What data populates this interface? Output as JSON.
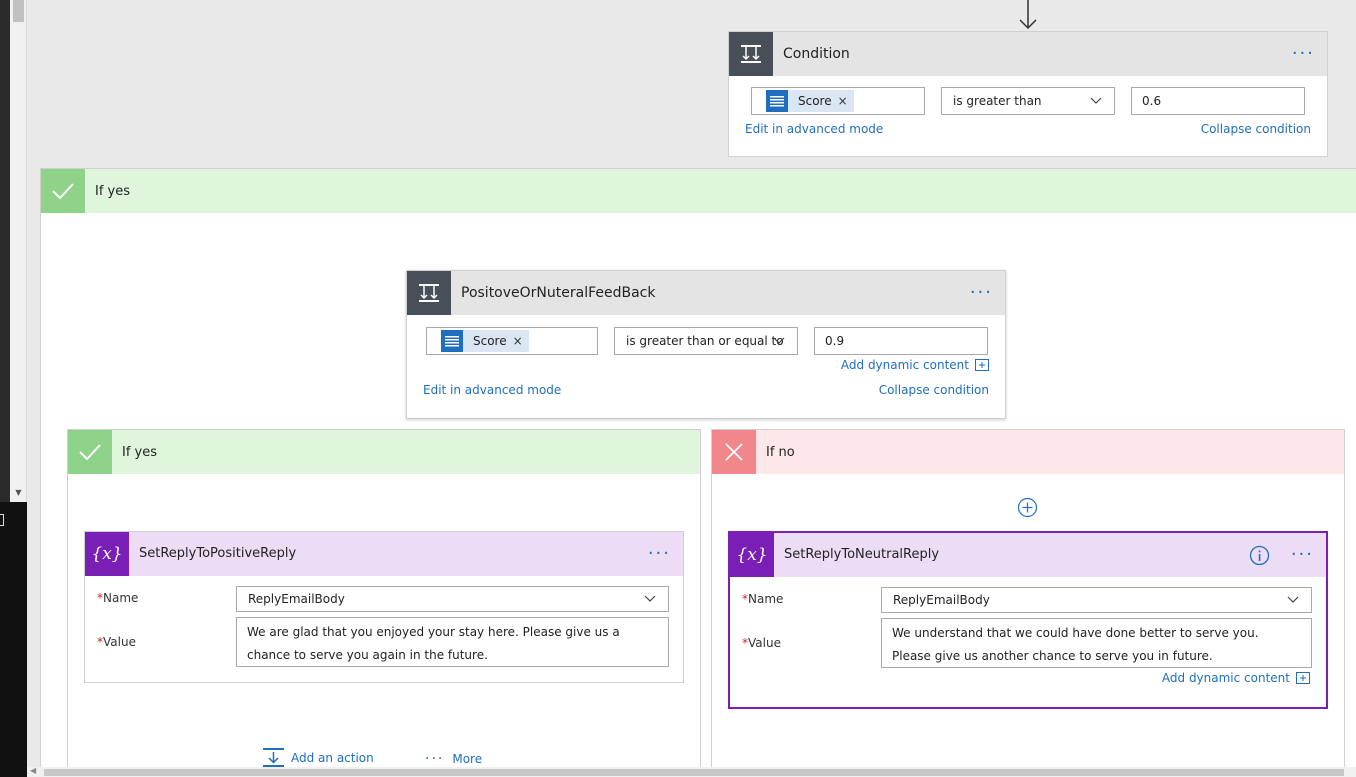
{
  "condition": {
    "title": "Condition",
    "token_label": "Score",
    "operator": "is greater than",
    "value": "0.6",
    "edit_advanced": "Edit in advanced mode",
    "collapse": "Collapse condition",
    "more": "···"
  },
  "outer_yes": {
    "label": "If yes"
  },
  "nested_condition": {
    "title": "PositoveOrNuteralFeedBack",
    "token_label": "Score",
    "operator": "is greater than or equal to",
    "value": "0.9",
    "add_dynamic": "Add dynamic content",
    "edit_advanced": "Edit in advanced mode",
    "collapse": "Collapse condition",
    "more": "···"
  },
  "inner_yes": {
    "label": "If yes",
    "action": {
      "title": "SetReplyToPositiveReply",
      "icon_text": "{x}",
      "name_label": "Name",
      "name_value": "ReplyEmailBody",
      "value_label": "Value",
      "value_text": "We are glad that you enjoyed your stay here. Please give us a chance to serve you again in the future.",
      "more": "···"
    },
    "add_action": "Add an action",
    "more_label": "More",
    "more_dots": "···"
  },
  "inner_no": {
    "label": "If no",
    "action": {
      "title": "SetReplyToNeutralReply",
      "icon_text": "{x}",
      "name_label": "Name",
      "name_value": "ReplyEmailBody",
      "value_label": "Value",
      "value_text": "We understand that we could have done better to serve you. Please give us another chance to serve you in future.",
      "add_dynamic": "Add dynamic content",
      "more": "···"
    }
  },
  "required_marker": "*",
  "token_remove": "×",
  "colors": {
    "accent_blue": "#1f6fbf",
    "condition_icon_bg": "#484f58",
    "variable_purple": "#7a1fb5",
    "yes_green": "#8fd38a",
    "no_red": "#f1868b"
  },
  "icons": {
    "condition": "condition-icon",
    "variable": "variable-icon",
    "yes": "checkmark-icon",
    "no": "close-icon",
    "token": "dynamic-content-icon",
    "info": "info-icon",
    "add": "plus-circle-icon",
    "add_action": "add-action-icon"
  }
}
